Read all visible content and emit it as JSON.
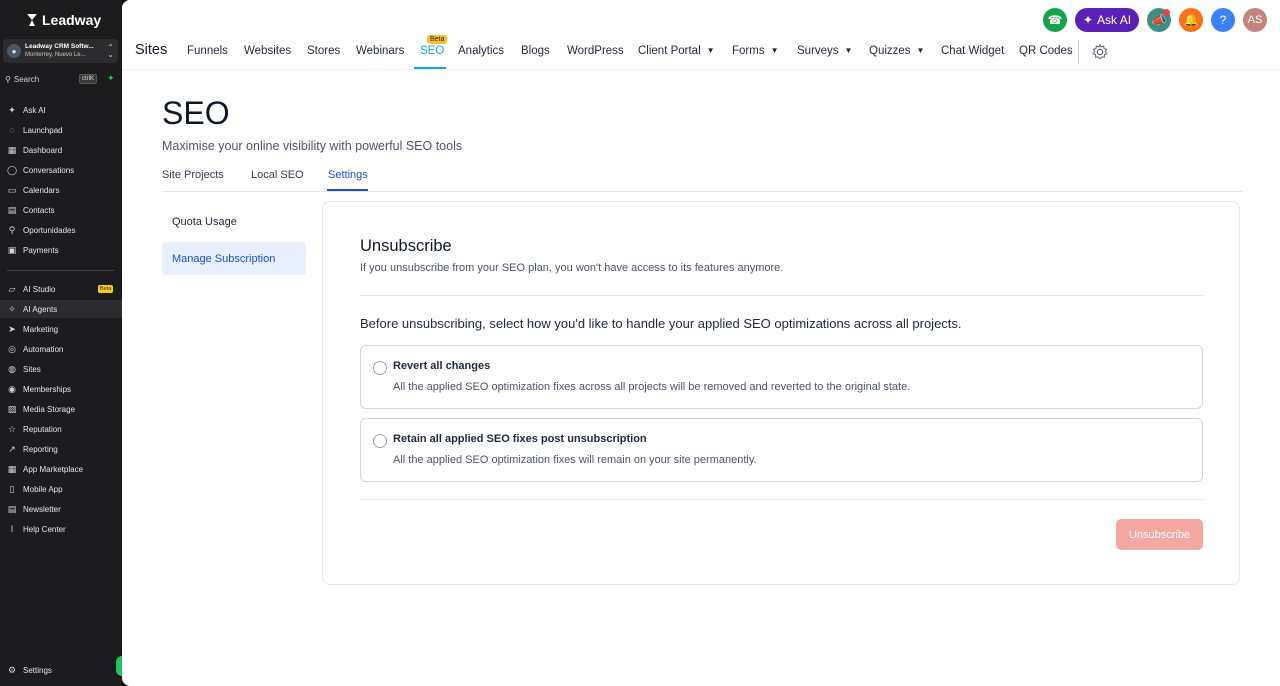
{
  "sidebar": {
    "logo": "Leadway",
    "account": {
      "name": "Leadway CRM Softw...",
      "location": "Monterrey, Nuevo Le..."
    },
    "search": {
      "label": "Search",
      "shortcut": "ctrlK"
    },
    "items_top": [
      {
        "label": "Ask AI",
        "icon": "sparkle-icon"
      },
      {
        "label": "Launchpad",
        "icon": "rocket-icon"
      },
      {
        "label": "Dashboard",
        "icon": "grid-icon"
      },
      {
        "label": "Conversations",
        "icon": "chat-icon"
      },
      {
        "label": "Calendars",
        "icon": "calendar-icon"
      },
      {
        "label": "Contacts",
        "icon": "contacts-icon"
      },
      {
        "label": "Oportunidades",
        "icon": "filter-icon"
      },
      {
        "label": "Payments",
        "icon": "payments-icon"
      }
    ],
    "items_bottom": [
      {
        "label": "AI Studio",
        "icon": "ai-studio-icon"
      },
      {
        "label": "AI Agents",
        "icon": "agents-icon"
      },
      {
        "label": "Marketing",
        "icon": "send-icon"
      },
      {
        "label": "Automation",
        "icon": "automation-icon"
      },
      {
        "label": "Sites",
        "icon": "globe-icon"
      },
      {
        "label": "Memberships",
        "icon": "memberships-icon"
      },
      {
        "label": "Media Storage",
        "icon": "image-icon"
      },
      {
        "label": "Reputation",
        "icon": "star-icon"
      },
      {
        "label": "Reporting",
        "icon": "chart-icon"
      },
      {
        "label": "App Marketplace",
        "icon": "apps-icon"
      },
      {
        "label": "Mobile App",
        "icon": "phone-icon"
      },
      {
        "label": "Newsletter",
        "icon": "newsletter-icon"
      },
      {
        "label": "Help Center",
        "icon": "help-icon"
      }
    ],
    "ai_studio_badge": "Beta",
    "settings": "Settings"
  },
  "topbar": {
    "brand": "Sites",
    "nav": [
      "Funnels",
      "Websites",
      "Stores",
      "Webinars",
      "SEO",
      "Analytics",
      "Blogs",
      "WordPress",
      "Client Portal",
      "Forms",
      "Surveys",
      "Quizzes",
      "Chat Widget",
      "QR Codes"
    ],
    "seo_badge": "Beta",
    "ask_ai": "Ask AI",
    "avatar_initials": "AS",
    "help": "?"
  },
  "page": {
    "title": "SEO",
    "subtitle": "Maximise your online visibility with powerful SEO tools",
    "tabs": [
      "Site Projects",
      "Local SEO",
      "Settings"
    ],
    "settings_menu": [
      "Quota Usage",
      "Manage Subscription"
    ]
  },
  "card": {
    "title": "Unsubscribe",
    "description": "If you unsubscribe from your SEO plan, you won't have access to its features anymore.",
    "question": "Before unsubscribing, select how you'd like to handle your applied SEO optimizations across all projects.",
    "options": [
      {
        "title": "Revert all changes",
        "description": "All the applied SEO optimization fixes across all projects will be removed and reverted to the original state."
      },
      {
        "title": "Retain all applied SEO fixes post unsubscription",
        "description": "All the applied SEO optimization fixes will remain on your site permanently."
      }
    ],
    "button": "Unsubscribe"
  },
  "colors": {
    "accent": "#0ea5e9",
    "active_tab": "#1d4ed8",
    "ask_ai": "#5b21b6",
    "unsubscribe_disabled": "#f3a8a2"
  }
}
